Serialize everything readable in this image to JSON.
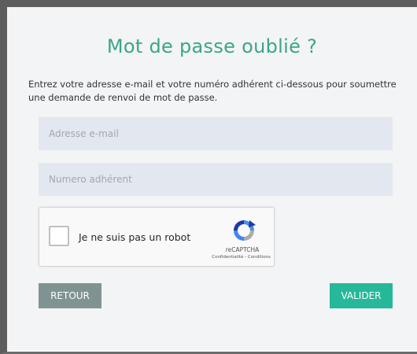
{
  "form": {
    "title": "Mot de passe oublié ?",
    "description": "Entrez votre adresse e-mail et votre numéro adhérent ci-dessous pour soumettre une demande de renvoi de mot de passe.",
    "email_placeholder": "Adresse e-mail",
    "email_value": "",
    "member_placeholder": "Numero adhérent",
    "member_value": ""
  },
  "captcha": {
    "checkbox_label": "Je ne suis pas un robot",
    "checked": false,
    "brand": "reCAPTCHA",
    "terms": "Confidentialité - Conditions",
    "logo_icon": "recaptcha-logo-icon"
  },
  "actions": {
    "back_label": "RETOUR",
    "submit_label": "VALIDER"
  },
  "colors": {
    "title": "#3aa58b",
    "submit_button": "#26b89a",
    "back_button": "#7f9492",
    "field_background": "#e3e7ef",
    "panel_background": "#f3f4f5"
  }
}
